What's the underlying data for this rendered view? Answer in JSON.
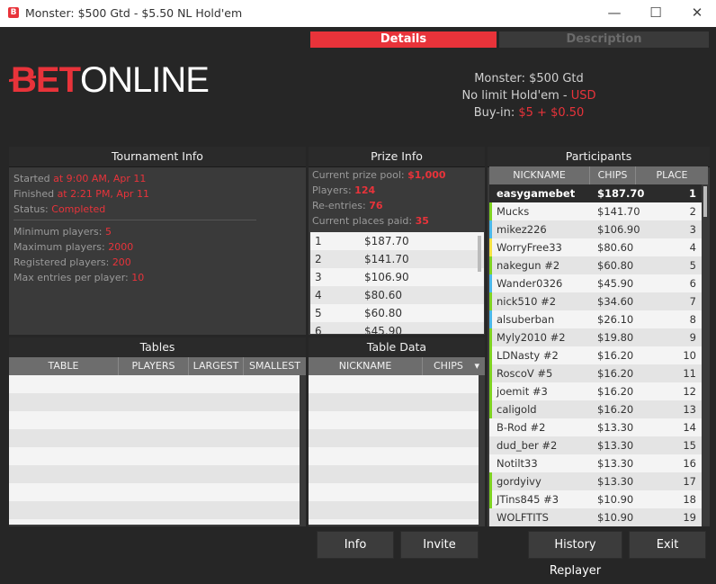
{
  "window": {
    "title": "Monster: $500 Gtd - $5.50 NL Hold'em",
    "app_icon": "B",
    "minimize": "—",
    "maximize": "☐",
    "close": "✕"
  },
  "tabs": {
    "details": "Details",
    "description": "Description"
  },
  "logo": {
    "bet": "BET",
    "online": "ONLINE"
  },
  "summary": {
    "name": "Monster: $500 Gtd",
    "game_prefix": "No limit Hold'em - ",
    "currency": "USD",
    "buyin_label": "Buy-in: ",
    "buyin_value": "$5 + $0.50"
  },
  "tournament_info": {
    "title": "Tournament Info",
    "started_label": "Started ",
    "started_value": "at 9:00 AM, Apr 11",
    "finished_label": "Finished ",
    "finished_value": "at 2:21 PM, Apr 11",
    "status_label": "Status: ",
    "status_value": "Completed",
    "min_label": "Minimum players: ",
    "min_value": "5",
    "max_label": "Maximum players: ",
    "max_value": "2000",
    "reg_label": "Registered players: ",
    "reg_value": "200",
    "maxentries_label": "Max entries per player: ",
    "maxentries_value": "10"
  },
  "prize_info": {
    "title": "Prize Info",
    "pool_label": "Current prize pool: ",
    "pool_value": "$1,000",
    "players_label": "Players: ",
    "players_value": "124",
    "reentries_label": "Re-entries: ",
    "reentries_value": "76",
    "places_label": "Current places paid: ",
    "places_value": "35",
    "prizes": [
      {
        "pos": "1",
        "amt": "$187.70"
      },
      {
        "pos": "2",
        "amt": "$141.70"
      },
      {
        "pos": "3",
        "amt": "$106.90"
      },
      {
        "pos": "4",
        "amt": "$80.60"
      },
      {
        "pos": "5",
        "amt": "$60.80"
      },
      {
        "pos": "6",
        "amt": "$45.90"
      }
    ]
  },
  "participants": {
    "title": "Participants",
    "col_nickname": "NICKNAME",
    "col_chips": "CHIPS",
    "col_place": "PLACE",
    "rows": [
      {
        "nick": "easygamebet",
        "chips": "$187.70",
        "place": "1",
        "bar": ""
      },
      {
        "nick": "Mucks",
        "chips": "$141.70",
        "place": "2",
        "bar": "#7ed321"
      },
      {
        "nick": "mikez226",
        "chips": "$106.90",
        "place": "3",
        "bar": "#4ab8ea"
      },
      {
        "nick": "WorryFree33",
        "chips": "$80.60",
        "place": "4",
        "bar": "#f4e242"
      },
      {
        "nick": "nakegun #2",
        "chips": "$60.80",
        "place": "5",
        "bar": "#7ed321"
      },
      {
        "nick": "Wander0326",
        "chips": "$45.90",
        "place": "6",
        "bar": "#4ab8ea"
      },
      {
        "nick": "nick510 #2",
        "chips": "$34.60",
        "place": "7",
        "bar": "#7ed321"
      },
      {
        "nick": "alsuberban",
        "chips": "$26.10",
        "place": "8",
        "bar": "#4ab8ea"
      },
      {
        "nick": "Myly2010 #2",
        "chips": "$19.80",
        "place": "9",
        "bar": "#7ed321"
      },
      {
        "nick": "LDNasty #2",
        "chips": "$16.20",
        "place": "10",
        "bar": "#7ed321"
      },
      {
        "nick": "RoscoV #5",
        "chips": "$16.20",
        "place": "11",
        "bar": "#7ed321"
      },
      {
        "nick": "joemit #3",
        "chips": "$16.20",
        "place": "12",
        "bar": "#7ed321"
      },
      {
        "nick": "caligold",
        "chips": "$16.20",
        "place": "13",
        "bar": "#7ed321"
      },
      {
        "nick": "B-Rod #2",
        "chips": "$13.30",
        "place": "14",
        "bar": ""
      },
      {
        "nick": "dud_ber #2",
        "chips": "$13.30",
        "place": "15",
        "bar": ""
      },
      {
        "nick": "Notilt33",
        "chips": "$13.30",
        "place": "16",
        "bar": ""
      },
      {
        "nick": "gordyivy",
        "chips": "$13.30",
        "place": "17",
        "bar": "#7ed321"
      },
      {
        "nick": "JTins845 #3",
        "chips": "$10.90",
        "place": "18",
        "bar": "#7ed321"
      },
      {
        "nick": "WOLFTITS",
        "chips": "$10.90",
        "place": "19",
        "bar": ""
      }
    ]
  },
  "tables": {
    "title": "Tables",
    "col_table": "TABLE",
    "col_players": "PLAYERS",
    "col_largest": "LARGEST",
    "col_smallest": "SMALLEST"
  },
  "table_data": {
    "title": "Table Data",
    "col_nickname": "NICKNAME",
    "col_chips": "CHIPS",
    "sort_icon": "▾"
  },
  "buttons": {
    "info": "Info",
    "invite": "Invite",
    "history": "History Replayer",
    "exit": "Exit"
  },
  "colors": {
    "accent": "#e8333a",
    "panel": "#3a3a3a",
    "background": "#262626"
  }
}
